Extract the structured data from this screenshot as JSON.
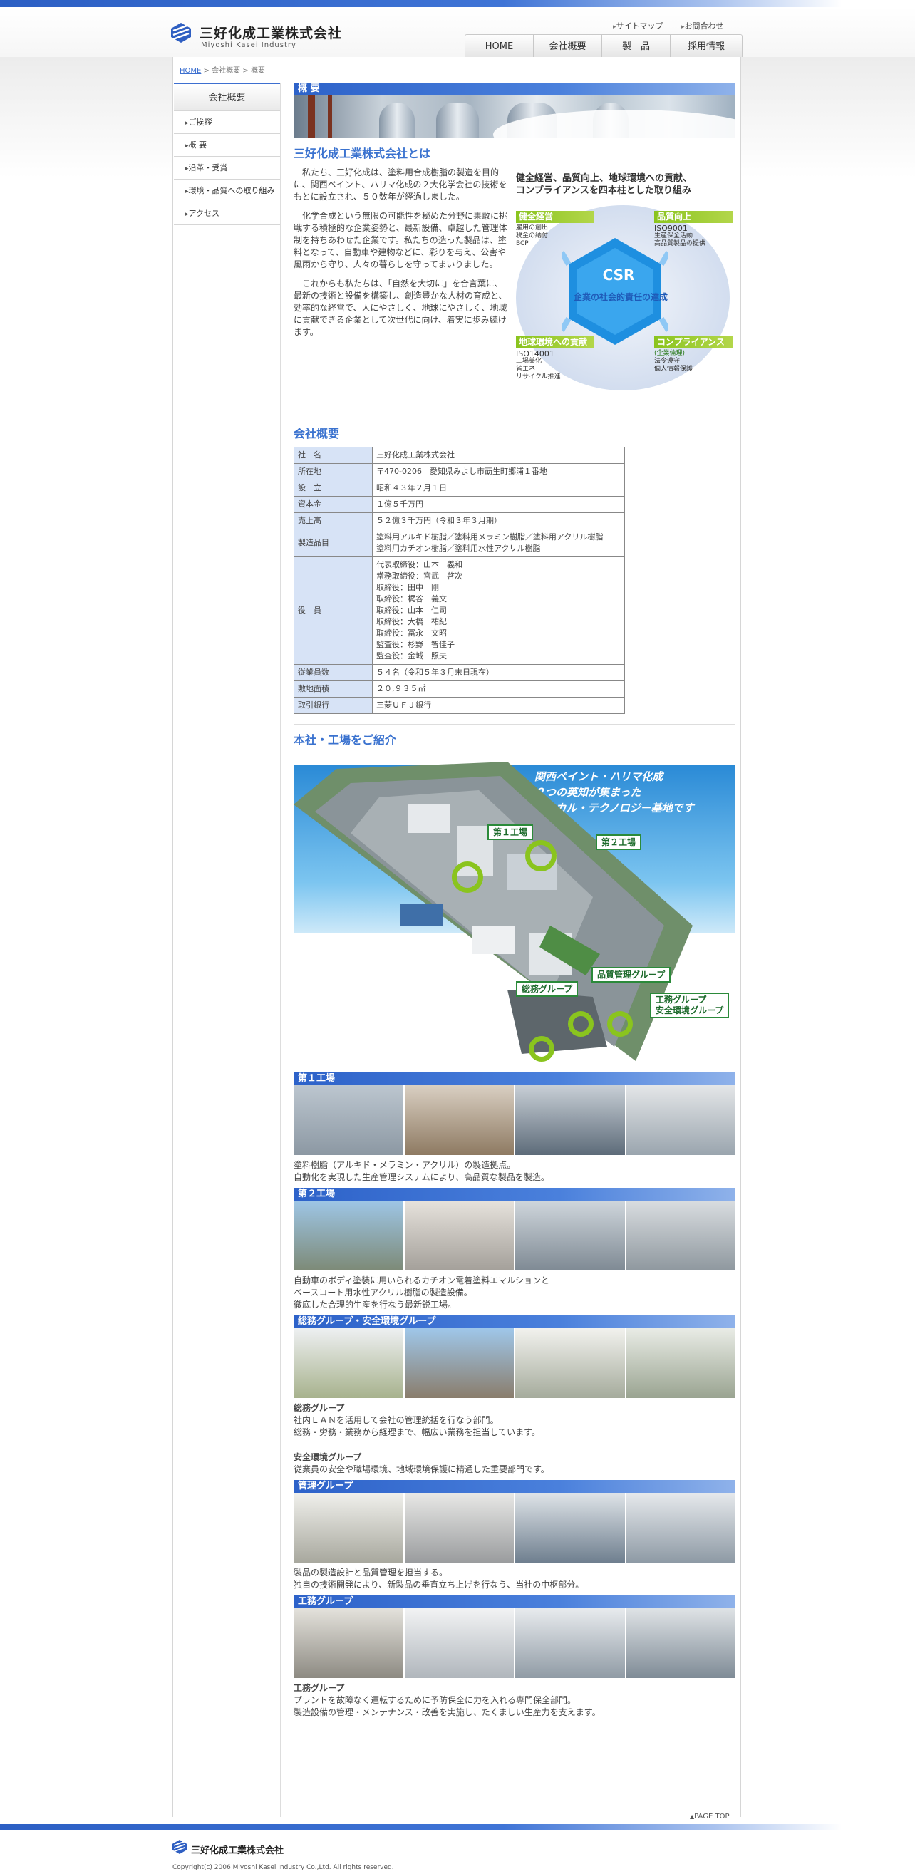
{
  "header": {
    "logo_jp": "三好化成工業株式会社",
    "logo_en": "Miyoshi Kasei Industry",
    "utility": [
      "サイトマップ",
      "お問合わせ"
    ],
    "nav": [
      "HOME",
      "会社概要",
      "製　品",
      "採用情報"
    ]
  },
  "breadcrumb": {
    "home": "HOME",
    "sep": " > ",
    "level1": "会社概要",
    "level2": "概要"
  },
  "sidebar": {
    "title": "会社概要",
    "items": [
      "ご挨拶",
      "概 要",
      "沿革・受賞",
      "環境・品質への取り組み",
      "アクセス"
    ]
  },
  "section_title": "概 要",
  "about": {
    "title": "三好化成工業株式会社とは",
    "p1": "　私たち、三好化成は、塗料用合成樹脂の製造を目的に、関西ペイント、ハリマ化成の２大化学会社の技術をもとに設立され、５０数年が経過しました。",
    "p2": "　化学合成という無限の可能性を秘めた分野に果敢に挑戦する積極的な企業姿勢と、最新設備、卓越した管理体制を持ちあわせた企業です。私たちの造った製品は、塗料となって、自動車や建物などに、彩りを与え、公害や風雨から守り、人々の暮らしを守ってまいりました。",
    "p3": "　これからも私たちは、「自然を大切に」を合言葉に、最新の技術と設備を構築し、創造豊かな人材の育成と、効率的な経営で、人にやさしく、地球にやさしく、地域に貢献できる企業として次世代に向け、着実に歩み続けます。"
  },
  "csr": {
    "heading1": "健全経営、品質向上、地球環境への貢献、",
    "heading2": "コンプライアンスを四本柱とした取り組み",
    "logo": "CSR",
    "subtitle": "企業の社会的責任の達成",
    "tl": {
      "label": "健全経営",
      "lines": [
        "雇用の創出",
        "税金の納付",
        "BCP"
      ]
    },
    "tr": {
      "label": "品質向上",
      "lines": [
        "ISO9001",
        "生産保全活動",
        "高品質製品の提供"
      ]
    },
    "bl": {
      "label": "地球環境への貢献",
      "lines": [
        "ISO14001",
        "工場美化",
        "省エネ",
        "リサイクル推進"
      ]
    },
    "br": {
      "label": "コンプライアンス",
      "sub": "(企業倫理)",
      "lines": [
        "法令遵守",
        "個人情報保護"
      ]
    }
  },
  "profile": {
    "title": "会社概要",
    "rows": [
      {
        "k": "社　名",
        "v": [
          "三好化成工業株式会社"
        ]
      },
      {
        "k": "所在地",
        "v": [
          "〒470-0206　愛知県みよし市莇生町郷浦１番地"
        ]
      },
      {
        "k": "設　立",
        "v": [
          "昭和４３年２月１日"
        ]
      },
      {
        "k": "資本金",
        "v": [
          "１億５千万円"
        ]
      },
      {
        "k": "売上高",
        "v": [
          "５２億３千万円（令和３年３月期）"
        ]
      },
      {
        "k": "製造品目",
        "v": [
          "塗料用アルキド樹脂／塗料用メラミン樹脂／塗料用アクリル樹脂",
          "塗料用カチオン樹脂／塗料用水性アクリル樹脂"
        ]
      },
      {
        "k": "役　員",
        "v": [
          "代表取締役：山本　義和",
          "常務取締役：宮武　啓次",
          "取締役：田中　剛",
          "取締役：梶谷　義文",
          "取締役：山本　仁司",
          "取締役：大橋　祐紀",
          "取締役：冨永　文昭",
          "監査役：杉野　智佳子",
          "監査役：金城　照夫"
        ]
      },
      {
        "k": "従業員数",
        "v": [
          "５４名（令和５年３月末日現在）"
        ]
      },
      {
        "k": "敷地面積",
        "v": [
          "２０,９３５㎡"
        ]
      },
      {
        "k": "取引銀行",
        "v": [
          "三菱ＵＦＪ銀行"
        ]
      }
    ]
  },
  "factory": {
    "title": "本社・工場をご紹介",
    "slogan": [
      "関西ペイント・ハリマ化成",
      "２つの英知が集まった",
      "ケミカル・テクノロジー基地です"
    ],
    "labels": {
      "f1": "第１工場",
      "f2": "第２工場",
      "gen": "総務グループ",
      "qc": "品質管理グループ",
      "eng1": "工務グループ",
      "eng2": "安全環境グループ"
    }
  },
  "units": [
    {
      "bar": "第１工場",
      "lines": [
        "塗料樹脂（アルキド・メラミン・アクリル）の製造拠点。",
        "自動化を実現した生産管理システムにより、高品質な製品を製造。"
      ]
    },
    {
      "bar": "第２工場",
      "lines": [
        "自動車のボディ塗装に用いられるカチオン電着塗料エマルションと",
        "ベースコート用水性アクリル樹脂の製造設備。",
        "徹底した合理的生産を行なう最新鋭工場。"
      ]
    },
    {
      "bar": "総務グループ・安全環境グループ",
      "groups": [
        {
          "name": "総務グループ",
          "lines": [
            "社内ＬＡＮを活用して会社の管理統括を行なう部門。",
            "総務・労務・業務から経理まで、幅広い業務を担当しています。"
          ]
        },
        {
          "name": "安全環境グループ",
          "lines": [
            "従業員の安全や職場環境、地域環境保護に精通した重要部門です。"
          ]
        }
      ]
    },
    {
      "bar": "管理グループ",
      "lines": [
        "製品の製造設計と品質管理を担当する。",
        "独自の技術開発により、新製品の垂直立ち上げを行なう、当社の中枢部分。"
      ]
    },
    {
      "bar": "工務グループ",
      "groups": [
        {
          "name": "工務グループ",
          "lines": [
            "プラントを故障なく運転するために予防保全に力を入れる専門保全部門。",
            "製造設備の管理・メンテナンス・改善を実施し、たくましい生産力を支えます。"
          ]
        }
      ]
    }
  ],
  "pagetop": "PAGE TOP",
  "footer": {
    "logo": "三好化成工業株式会社",
    "copyright": "Copyright(c) 2006 Miyoshi Kasei Industry Co.,Ltd. All rights reserved."
  },
  "colors": {
    "accent": "#3a72cf",
    "green": "#8ac41e",
    "table_key": "#d7e3f6"
  }
}
